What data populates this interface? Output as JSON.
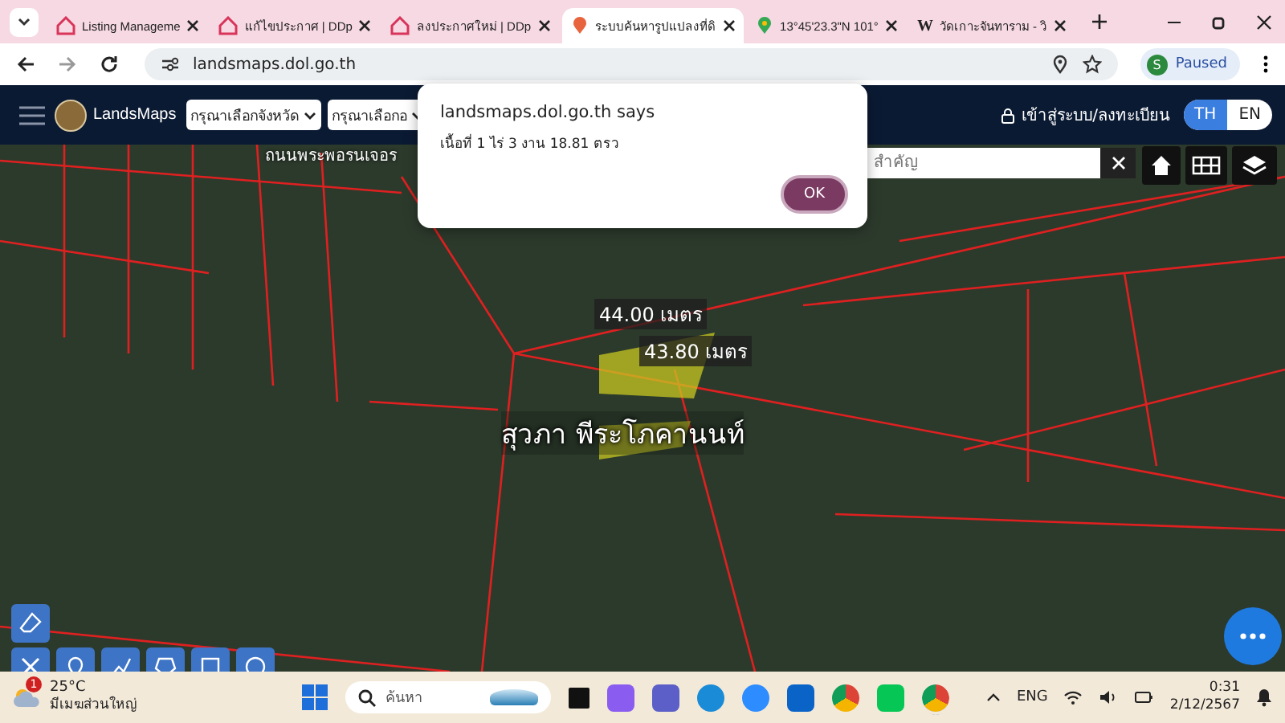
{
  "browser": {
    "tabs": [
      {
        "title": "Listing Manageme",
        "kind": "house",
        "selected": false
      },
      {
        "title": "แก้ไขประกาศ | DDp",
        "kind": "house",
        "selected": false
      },
      {
        "title": "ลงประกาศใหม่ | DDp",
        "kind": "house",
        "selected": false
      },
      {
        "title": "ระบบค้นหารูปแปลงที่ดิ",
        "kind": "pin",
        "selected": true
      },
      {
        "title": "13°45'23.3\"N 101°",
        "kind": "maps",
        "selected": false
      },
      {
        "title": "วัดเกาะจันทาราม - วิ",
        "kind": "letter",
        "icon_text": "W",
        "selected": false
      }
    ],
    "address": "landsmaps.dol.go.th",
    "profile": {
      "initial": "S",
      "status": "Paused"
    }
  },
  "app": {
    "brand": "LandsMaps",
    "selects": [
      "กรุณาเลือกจังหวัด",
      "กรุณาเลือกอ"
    ],
    "login": "เข้าสู่ระบบ/ลงทะเบียน",
    "languages": [
      {
        "label": "TH",
        "selected": true
      },
      {
        "label": "EN",
        "selected": false
      }
    ]
  },
  "map": {
    "road_label": "ถนนพระพอรนเจอร",
    "search_placeholder": "สำคัญ",
    "measurements": [
      "44.00 เมตร",
      "43.80 เมตร"
    ],
    "parcel_owner": "สุวภา พีระโภคานนท์"
  },
  "dialog": {
    "title": "landsmaps.dol.go.th says",
    "message": "เนื้อที่ 1 ไร่ 3 งาน 18.81 ตรว",
    "button": "OK"
  },
  "taskbar": {
    "temperature": "25°C",
    "condition": "มีเมฆส่วนใหญ่",
    "alert_count": "1",
    "search_placeholder": "ค้นหา",
    "language": "ENG",
    "time": "0:31",
    "date": "2/12/2567"
  }
}
